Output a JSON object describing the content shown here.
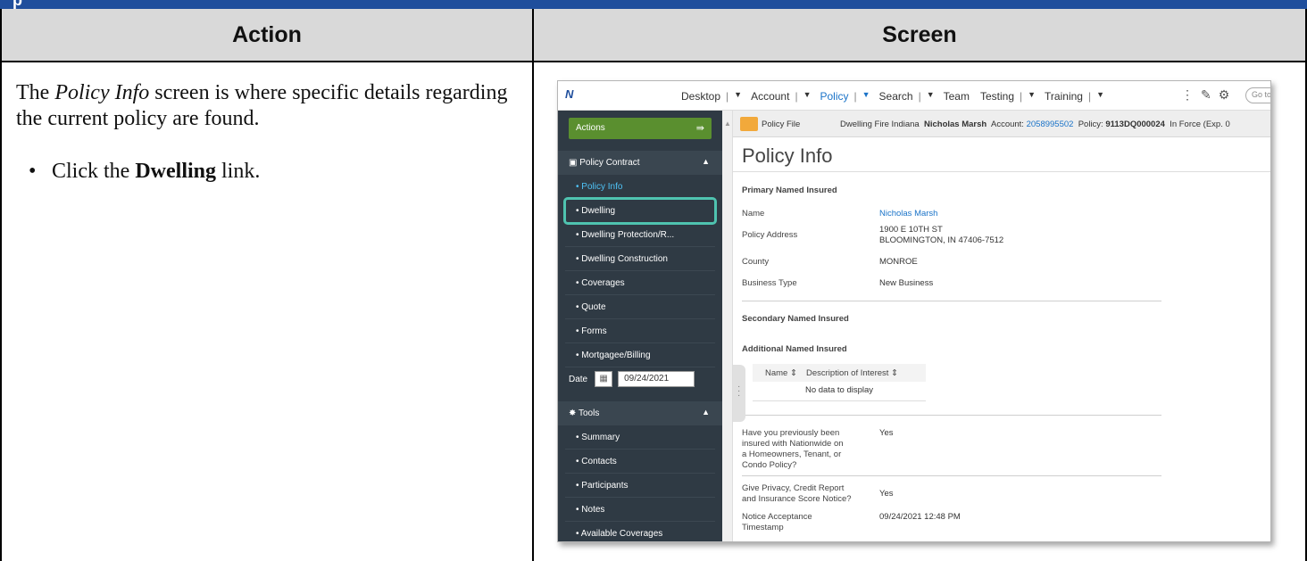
{
  "headers": {
    "action": "Action",
    "screen": "Screen"
  },
  "action_cell": {
    "intro_italic": "Policy Info",
    "intro_rest": " screen is where specific details regarding the current policy are found.",
    "intro_prefix": "The ",
    "bullet_prefix": "Click the ",
    "bullet_bold": "Dwelling",
    "bullet_suffix": " link."
  },
  "app": {
    "menu": [
      "Desktop",
      "Account",
      "Policy",
      "Search",
      "Team",
      "Testing",
      "Training"
    ],
    "goto_placeholder": "Go to",
    "actions_label": "Actions",
    "infobar": {
      "folder_label": "Policy File",
      "line": "Dwelling Fire  Indiana",
      "insured": "Nicholas Marsh",
      "account_label": "Account:",
      "account_number": "2058995502",
      "policy_label": "Policy:",
      "policy_number": "9113DQ000024",
      "status": "In Force (Exp. 0"
    },
    "sidebar": {
      "section_policy": "Policy Contract",
      "items": [
        "• Policy Info",
        "• Dwelling",
        "• Dwelling Protection/R...",
        "• Dwelling Construction",
        "• Coverages",
        "• Quote",
        "• Forms",
        "• Mortgagee/Billing"
      ],
      "date_label": "Date",
      "date_value": "09/24/2021",
      "section_tools": "Tools",
      "tools_items": [
        "• Summary",
        "• Contacts",
        "• Participants",
        "• Notes",
        "• Available Coverages"
      ]
    },
    "page_title": "Policy Info",
    "primary_named_insured": "Primary Named Insured",
    "fields": {
      "name_label": "Name",
      "name_value": "Nicholas Marsh",
      "address_label": "Policy Address",
      "address_line1": "1900 E 10TH ST",
      "address_line2": "BLOOMINGTON, IN 47406-7512",
      "county_label": "County",
      "county_value": "MONROE",
      "business_label": "Business Type",
      "business_value": "New Business"
    },
    "secondary_named_insured": "Secondary Named Insured",
    "additional_named_insured": "Additional Named Insured",
    "mini_table": {
      "col1": "Name ⇕",
      "col2": "Description of Interest ⇕",
      "empty": "No data to display"
    },
    "questions": {
      "q1_line1": "Have you previously been",
      "q1_line2": "insured with Nationwide on",
      "q1_line3": "a Homeowners, Tenant, or",
      "q1_line4": "Condo Policy?",
      "q1_value": "Yes",
      "q2_line1": "Give Privacy, Credit Report",
      "q2_line2": "and Insurance Score Notice?",
      "q2_value": "Yes",
      "q3_line1": "Notice Acceptance",
      "q3_line2": "Timestamp",
      "q3_value": "09/24/2021 12:48 PM"
    }
  }
}
